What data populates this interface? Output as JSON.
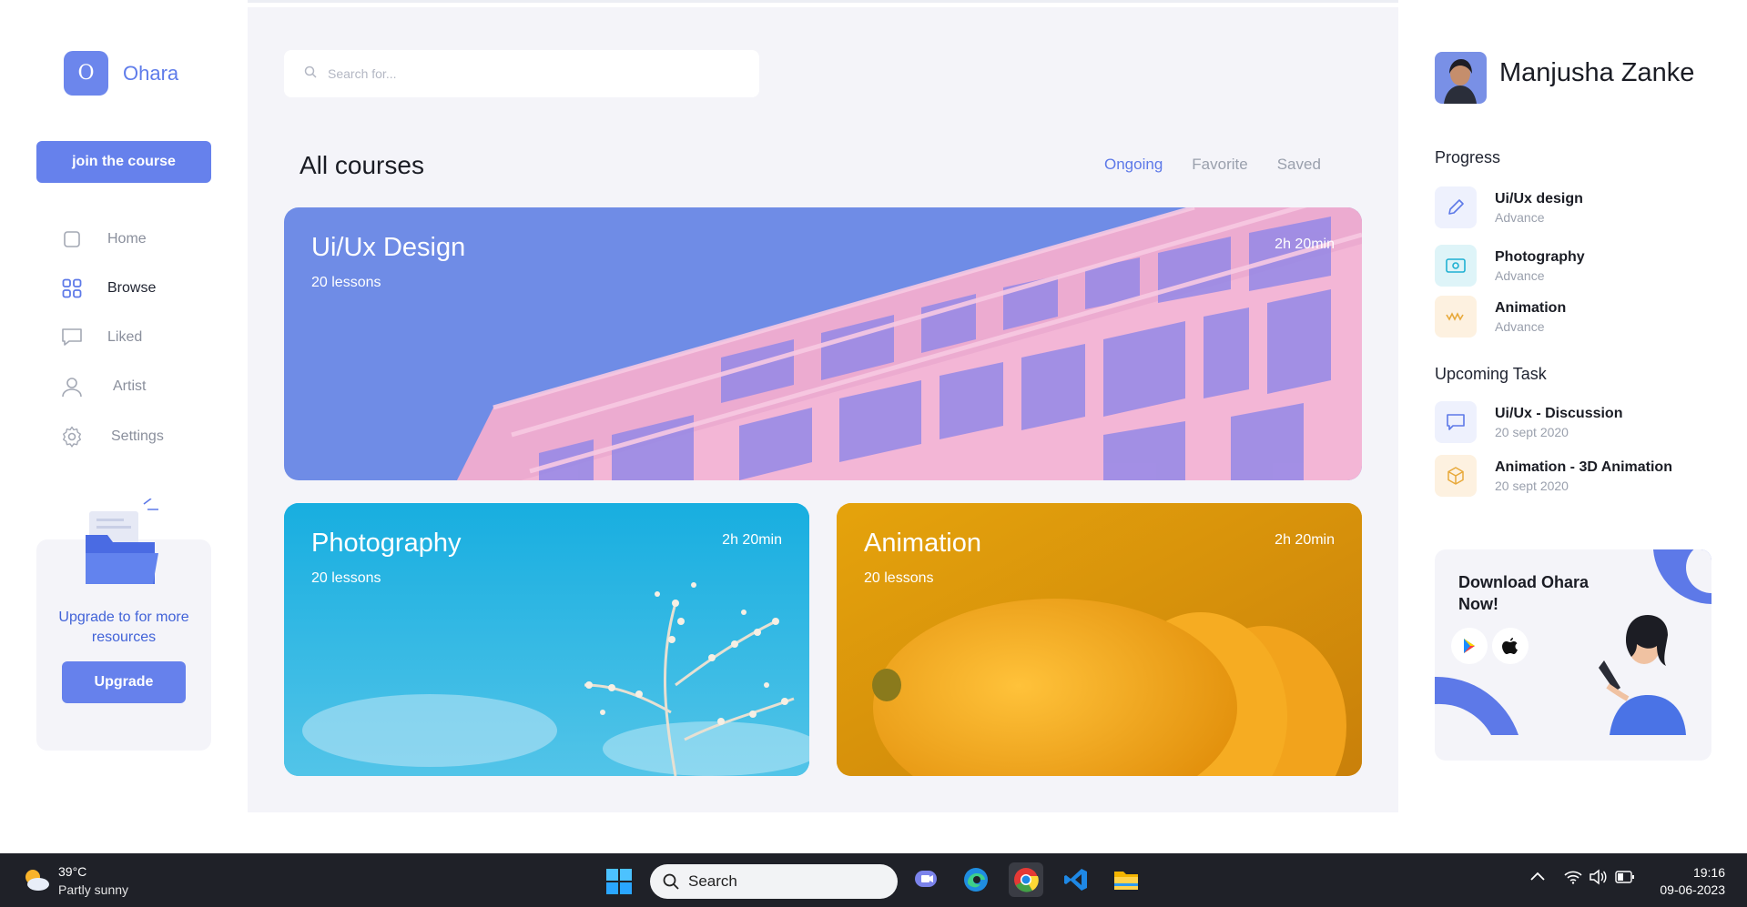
{
  "brand": {
    "logo_letter": "O",
    "name": "Ohara"
  },
  "sidebar": {
    "join_label": "join the course",
    "items": [
      {
        "label": "Home",
        "icon": "square-icon"
      },
      {
        "label": "Browse",
        "icon": "grid-icon",
        "active": true
      },
      {
        "label": "Liked",
        "icon": "chat-icon"
      },
      {
        "label": "Artist",
        "icon": "user-icon"
      },
      {
        "label": "Settings",
        "icon": "gear-icon"
      }
    ],
    "upgrade_text": "Upgrade to for more resources",
    "upgrade_label": "Upgrade"
  },
  "search": {
    "placeholder": "Search for..."
  },
  "courses": {
    "title": "All courses",
    "filters": [
      "Ongoing",
      "Favorite",
      "Saved"
    ],
    "active_filter": "Ongoing",
    "cards": [
      {
        "title": "Ui/Ux Design",
        "lessons": "20 lessons",
        "duration": "2h 20min",
        "color": "#6f8ce6"
      },
      {
        "title": "Photography",
        "lessons": "20 lessons",
        "duration": "2h 20min",
        "color": "#22b4e0"
      },
      {
        "title": "Animation",
        "lessons": "20 lessons",
        "duration": "2h 20min",
        "color": "#de9a06"
      }
    ]
  },
  "profile": {
    "name": "Manjusha Zanke"
  },
  "progress": {
    "title": "Progress",
    "items": [
      {
        "name": "Ui/Ux design",
        "level": "Advance",
        "icon": "pencil-icon",
        "bg": "#eef1fd",
        "color": "#5d79e8"
      },
      {
        "name": "Photography",
        "level": "Advance",
        "icon": "photo-icon",
        "bg": "#def4f8",
        "color": "#1fb0d2"
      },
      {
        "name": "Animation",
        "level": "Advance",
        "icon": "wave-icon",
        "bg": "#fdf1e0",
        "color": "#e8a93a"
      }
    ]
  },
  "upcoming": {
    "title": "Upcoming Task",
    "items": [
      {
        "name": "Ui/Ux - Discussion",
        "date": "20 sept 2020",
        "icon": "message-icon",
        "bg": "#eef1fd",
        "color": "#5d79e8"
      },
      {
        "name": "Animation - 3D Animation",
        "date": "20 sept 2020",
        "icon": "cube-icon",
        "bg": "#fdf1e0",
        "color": "#e8a93a"
      }
    ]
  },
  "download": {
    "title": "Download Ohara Now!"
  },
  "taskbar": {
    "temp": "39°C",
    "weather": "Partly sunny",
    "search_label": "Search",
    "time": "19:16",
    "date": "09-06-2023"
  },
  "colors": {
    "accent": "#6681ec",
    "main_bg": "#f4f4f9"
  }
}
